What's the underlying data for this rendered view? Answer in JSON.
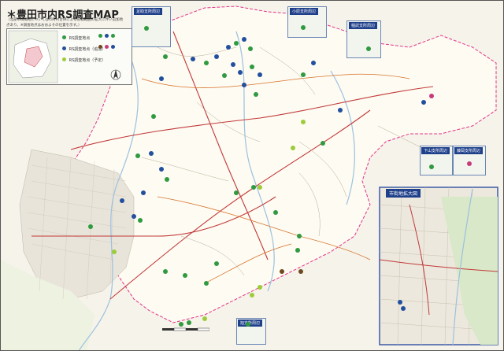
{
  "map": {
    "title": "＊豊田市内RS調査MAP",
    "note": "（北部市山間地については市町村合併による管轄範囲の拡大に伴い追加地点あり。※調査地点はおおよその位置を示す。）",
    "inset_titles": [
      "足助支所周辺",
      "小原支所周辺",
      "稲武支所周辺",
      "下山支所周辺",
      "藤岡支所周辺",
      "旭支所周辺",
      "市街地拡大図"
    ],
    "legend": {
      "items": [
        "RS調査地点",
        "RS調査地点（追加）",
        "RS調査地点（予定）"
      ]
    },
    "colors": {
      "green": "#2f9a3f",
      "blue": "#234f9f",
      "yellowgreen": "#9dcc3a",
      "brown": "#6d4a1f",
      "magenta": "#c83a7a",
      "road": "#c23a3a"
    },
    "icon_names": [
      "north-arrow-icon",
      "scale-bar-icon"
    ]
  }
}
